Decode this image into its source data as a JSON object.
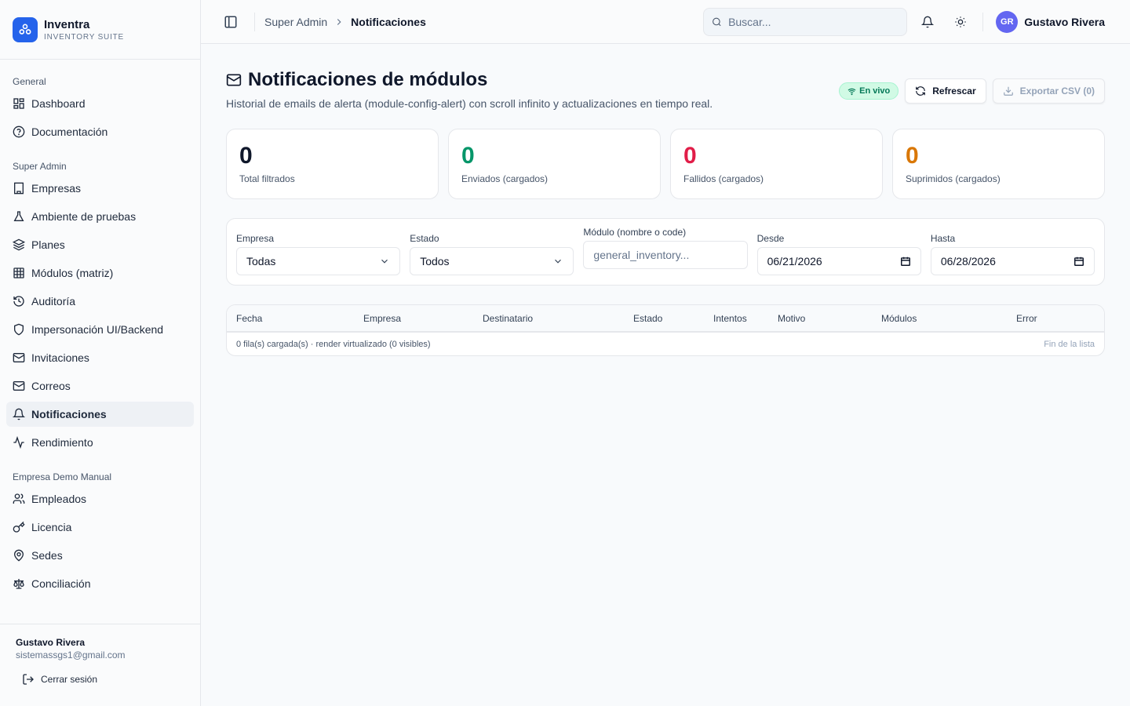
{
  "brand": {
    "name": "Inventra",
    "subtitle": "INVENTORY SUITE"
  },
  "sidebar": {
    "groups": [
      {
        "title": "General",
        "items": [
          {
            "label": "Dashboard",
            "icon": "dashboard-icon"
          },
          {
            "label": "Documentación",
            "icon": "help-circle-icon"
          }
        ]
      },
      {
        "title": "Super Admin",
        "items": [
          {
            "label": "Empresas",
            "icon": "building-icon"
          },
          {
            "label": "Ambiente de pruebas",
            "icon": "flask-icon"
          },
          {
            "label": "Planes",
            "icon": "layers-icon"
          },
          {
            "label": "Módulos (matriz)",
            "icon": "table-icon"
          },
          {
            "label": "Auditoría",
            "icon": "history-icon"
          },
          {
            "label": "Impersonación UI/Backend",
            "icon": "shield-icon"
          },
          {
            "label": "Invitaciones",
            "icon": "mail-icon"
          },
          {
            "label": "Correos",
            "icon": "mail-icon"
          },
          {
            "label": "Notificaciones",
            "icon": "bell-icon",
            "active": true
          },
          {
            "label": "Rendimiento",
            "icon": "activity-icon"
          }
        ]
      },
      {
        "title": "Empresa Demo Manual",
        "items": [
          {
            "label": "Empleados",
            "icon": "users-icon"
          },
          {
            "label": "Licencia",
            "icon": "key-icon"
          },
          {
            "label": "Sedes",
            "icon": "map-pin-icon"
          },
          {
            "label": "Conciliación",
            "icon": "scale-icon"
          }
        ]
      }
    ],
    "footer": {
      "name": "Gustavo Rivera",
      "email": "sistemassgs1@gmail.com",
      "logout": "Cerrar sesión"
    }
  },
  "topbar": {
    "breadcrumb": [
      "Super Admin",
      "Notificaciones"
    ],
    "search_placeholder": "Buscar...",
    "user": {
      "initials": "GR",
      "name": "Gustavo Rivera"
    }
  },
  "page": {
    "title": "Notificaciones de módulos",
    "subtitle": "Historial de emails de alerta (module-config-alert) con scroll infinito y actualizaciones en tiempo real.",
    "live_badge": "En vivo",
    "refresh_label": "Refrescar",
    "export_label": "Exportar CSV (0)"
  },
  "stats": [
    {
      "value": "0",
      "label": "Total filtrados",
      "color": "#0f172a"
    },
    {
      "value": "0",
      "label": "Enviados (cargados)",
      "color": "#059669"
    },
    {
      "value": "0",
      "label": "Fallidos (cargados)",
      "color": "#e11d48"
    },
    {
      "value": "0",
      "label": "Suprimidos (cargados)",
      "color": "#d97706"
    }
  ],
  "filters": {
    "empresa": {
      "label": "Empresa",
      "value": "Todas"
    },
    "estado": {
      "label": "Estado",
      "value": "Todos"
    },
    "modulo": {
      "label": "Módulo (nombre o code)",
      "placeholder": "general_inventory..."
    },
    "desde": {
      "label": "Desde",
      "value": "06/21/2026"
    },
    "hasta": {
      "label": "Hasta",
      "value": "06/28/2026"
    }
  },
  "table": {
    "columns": [
      "Fecha",
      "Empresa",
      "Destinatario",
      "Estado",
      "Intentos",
      "Motivo",
      "Módulos",
      "Error"
    ],
    "footer_left": "0 fila(s) cargada(s) · render virtualizado (0 visibles)",
    "footer_right": "Fin de la lista"
  }
}
